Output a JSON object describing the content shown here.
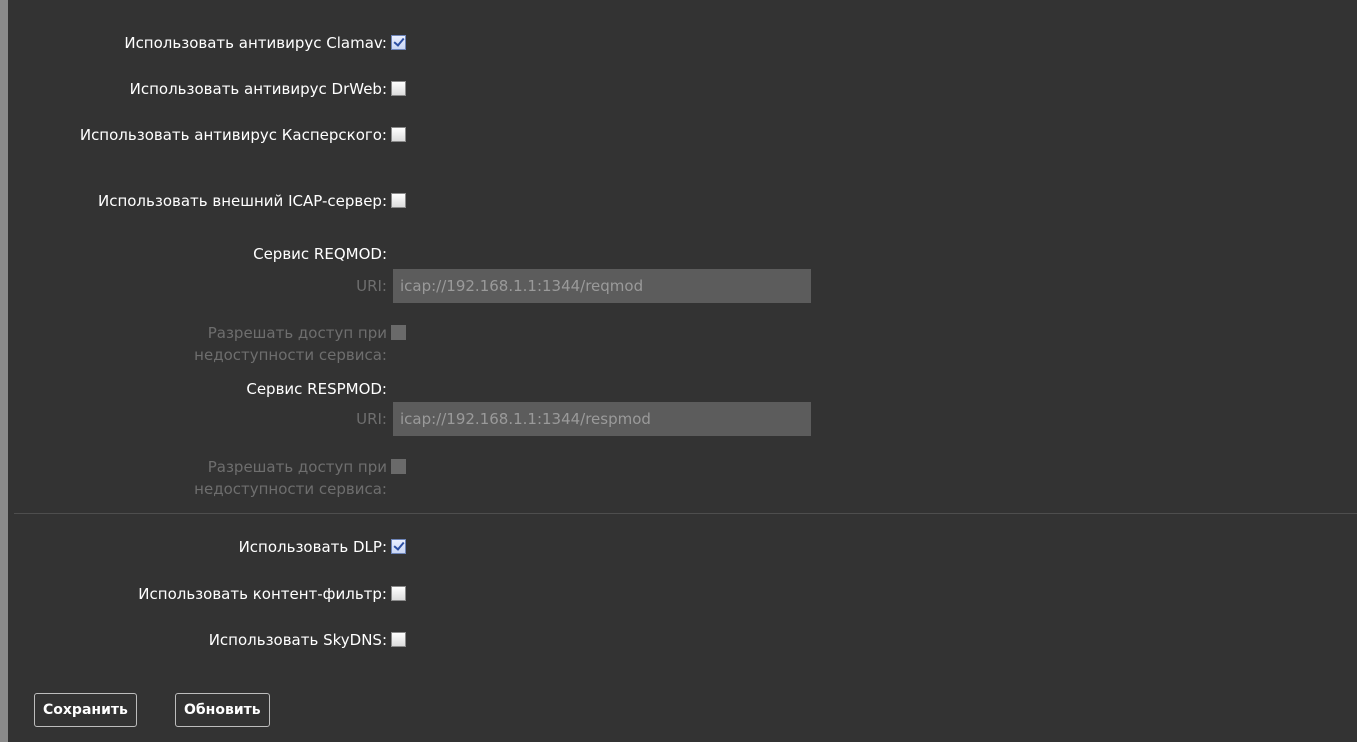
{
  "settings": {
    "clamav": {
      "label": "Использовать антивирус Clamav:",
      "checked": true
    },
    "drweb": {
      "label": "Использовать антивирус DrWeb:",
      "checked": false
    },
    "kaspersky": {
      "label": "Использовать антивирус Касперского:",
      "checked": false
    },
    "icap": {
      "label": "Использовать внешний ICAP-сервер:",
      "checked": false
    },
    "reqmod": {
      "title": "Сервис REQMOD:",
      "uri_label": "URI:",
      "uri_value": "icap://192.168.1.1:1344/reqmod",
      "allow_label": "Разрешать доступ при недоступности сервиса:"
    },
    "respmod": {
      "title": "Сервис RESPMOD:",
      "uri_label": "URI:",
      "uri_value": "icap://192.168.1.1:1344/respmod",
      "allow_label": "Разрешать доступ при недоступности сервиса:"
    },
    "dlp": {
      "label": "Использовать DLP:",
      "checked": true
    },
    "content_filter": {
      "label": "Использовать контент-фильтр:",
      "checked": false
    },
    "skydns": {
      "label": "Использовать SkyDNS:",
      "checked": false
    }
  },
  "buttons": {
    "save": "Сохранить",
    "refresh": "Обновить"
  }
}
